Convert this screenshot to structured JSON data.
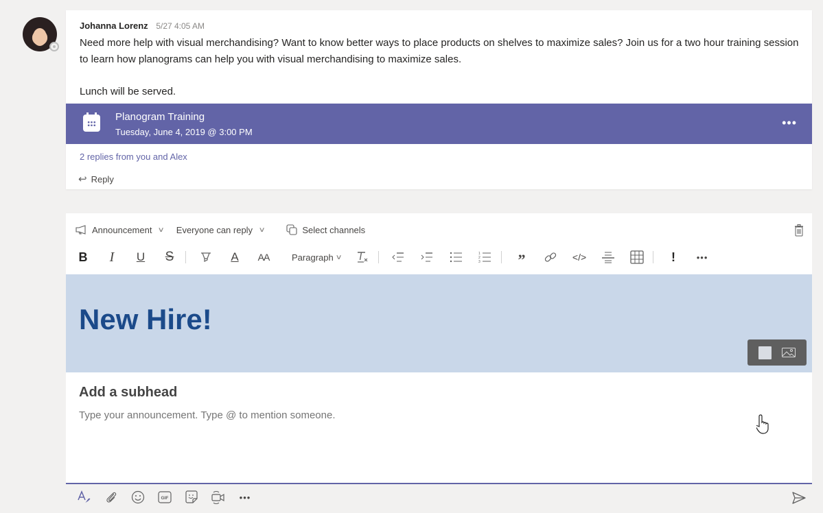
{
  "message": {
    "author": "Johanna Lorenz",
    "timestamp": "5/27 4:05 AM",
    "paragraphs": [
      "Need more help with visual merchandising? Want to know better ways to place products on shelves to maximize sales? Join us for a two hour training session to learn how planograms can help you with visual merchandising to maximize sales.",
      "Lunch will be served."
    ],
    "event": {
      "icon": "calendar-icon",
      "title": "Planogram Training",
      "datetime": "Tuesday, June 4, 2019 @ 3:00 PM",
      "more_label": "•••"
    },
    "replies_summary": "2 replies from you and Alex",
    "reply_label": "Reply"
  },
  "composer": {
    "options": {
      "post_type": "Announcement",
      "reply_setting": "Everyone can reply",
      "channels": "Select channels"
    },
    "format_toolbar": {
      "bold": "B",
      "italic": "I",
      "underline": "U",
      "strike": "S",
      "font_color": "A",
      "font_size": "AA",
      "paragraph": "Paragraph",
      "clear_format": "Tx",
      "more": "•••",
      "icons": [
        "bold-icon",
        "italic-icon",
        "underline-icon",
        "strikethrough-icon",
        "highlight-icon",
        "font-color-icon",
        "font-size-icon",
        "paragraph-dropdown",
        "clear-formatting-icon",
        "decrease-indent-icon",
        "increase-indent-icon",
        "bulleted-list-icon",
        "numbered-list-icon",
        "quote-icon",
        "link-icon",
        "code-snippet-icon",
        "horizontal-rule-icon",
        "insert-table-icon",
        "mark-important-icon",
        "more-options-icon"
      ]
    },
    "banner": {
      "headline": "New Hire!",
      "background_color": "#c9d7e9",
      "headline_color": "#1b4a8a"
    },
    "subhead_placeholder": "Add a subhead",
    "body_placeholder": "Type your announcement. Type @ to mention someone.",
    "bottom_toolbar": {
      "icons": [
        "format-icon",
        "attach-icon",
        "emoji-icon",
        "gif-icon",
        "sticker-icon",
        "meet-now-icon",
        "more-options-icon"
      ],
      "more_label": "•••"
    }
  },
  "colors": {
    "accent": "#6264a7",
    "background": "#f2f1f0"
  }
}
